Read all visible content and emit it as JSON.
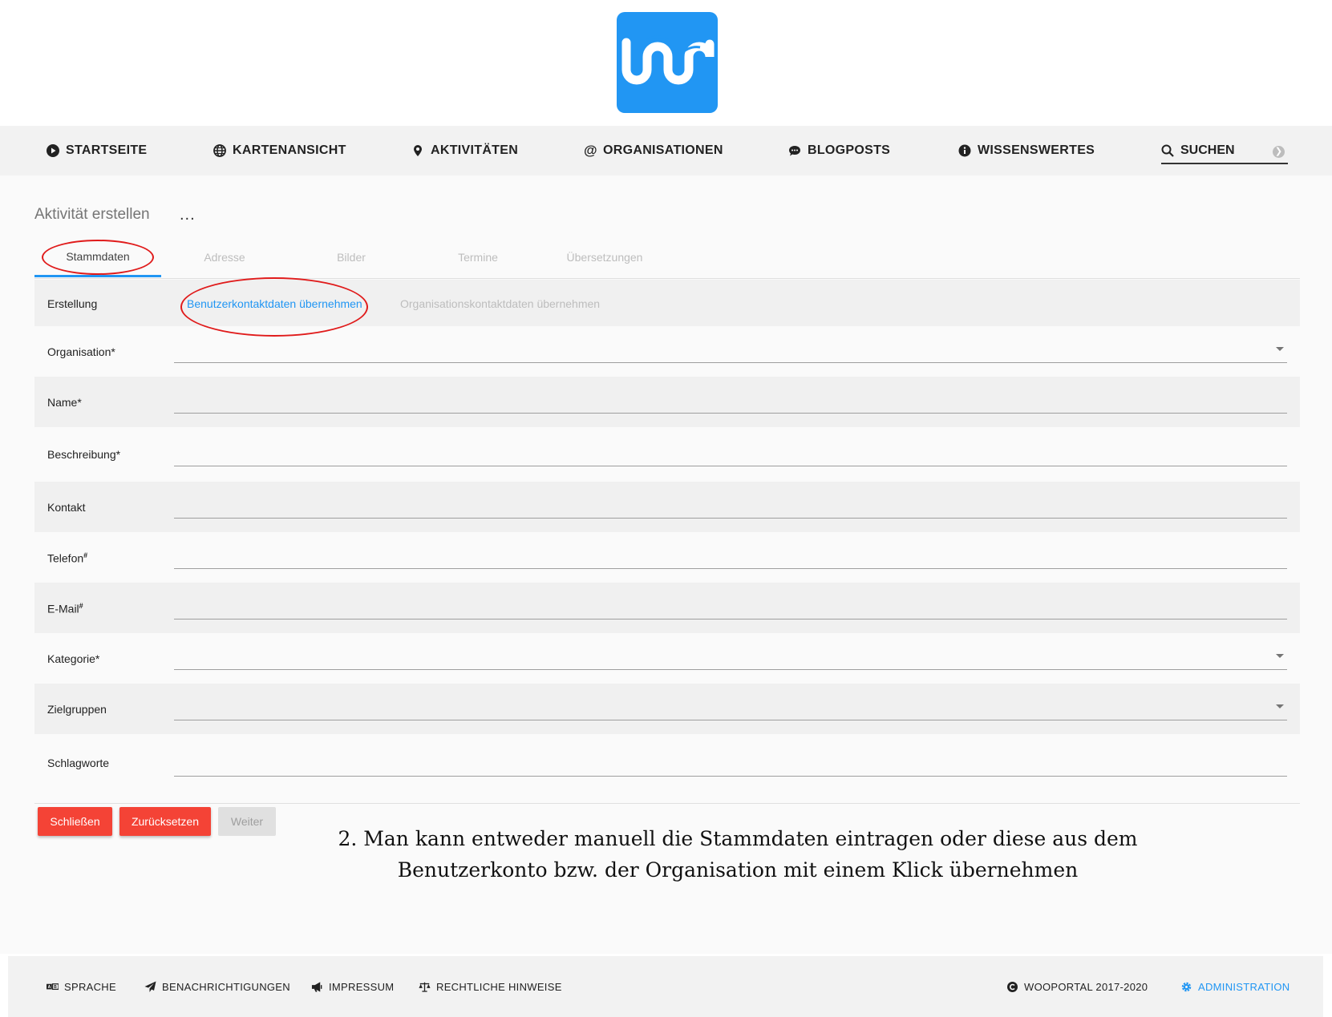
{
  "brand": {
    "logo_icon": "wooportal-logo-icon",
    "accent": "#2196f3"
  },
  "nav": {
    "items": [
      {
        "label": "STARTSEITE",
        "icon": "play-circle-icon"
      },
      {
        "label": "KARTENANSICHT",
        "icon": "globe-icon"
      },
      {
        "label": "AKTIVITÄTEN",
        "icon": "map-pin-icon"
      },
      {
        "label": "ORGANISATIONEN",
        "icon": "at-icon"
      },
      {
        "label": "BLOGPOSTS",
        "icon": "chat-bubble-icon"
      },
      {
        "label": "WISSENSWERTES",
        "icon": "info-icon"
      }
    ],
    "search_label": "SUCHEN"
  },
  "page": {
    "title": "Aktivität erstellen",
    "more": "...",
    "tabs": [
      "Stammdaten",
      "Adresse",
      "Bilder",
      "Termine",
      "Übersetzungen"
    ]
  },
  "form": {
    "creation_label": "Erstellung",
    "user_contact_link": "Benutzerkontaktdaten übernehmen",
    "org_contact_link": "Organisationskontaktdaten übernehmen",
    "fields": [
      {
        "label": "Organisation*",
        "dropdown": true
      },
      {
        "label": "Name*",
        "dropdown": false
      },
      {
        "label": "Beschreibung*",
        "dropdown": false
      },
      {
        "label": "Kontakt",
        "dropdown": false
      },
      {
        "label": "Telefon",
        "sup": "#",
        "dropdown": false
      },
      {
        "label": "E-Mail",
        "sup": "#",
        "dropdown": false
      },
      {
        "label": "Kategorie*",
        "dropdown": true
      },
      {
        "label": "Zielgruppen",
        "dropdown": true
      },
      {
        "label": "Schlagworte",
        "dropdown": false
      }
    ]
  },
  "buttons": {
    "close": "Schließen",
    "reset": "Zurücksetzen",
    "next": "Weiter"
  },
  "annotation": {
    "line1": "2. Man kann entweder manuell die Stammdaten eintragen oder diese aus dem",
    "line2": "Benutzerkonto bzw. der Organisation mit einem Klick übernehmen",
    "highlight_color": "#e01b1b"
  },
  "footer": {
    "language": "SPRACHE",
    "notifications": "BENACHRICHTIGUNGEN",
    "imprint": "IMPRESSUM",
    "legal": "RECHTLICHE HINWEISE",
    "copyright": "WOOPORTAL 2017-2020",
    "admin": "ADMINISTRATION"
  }
}
